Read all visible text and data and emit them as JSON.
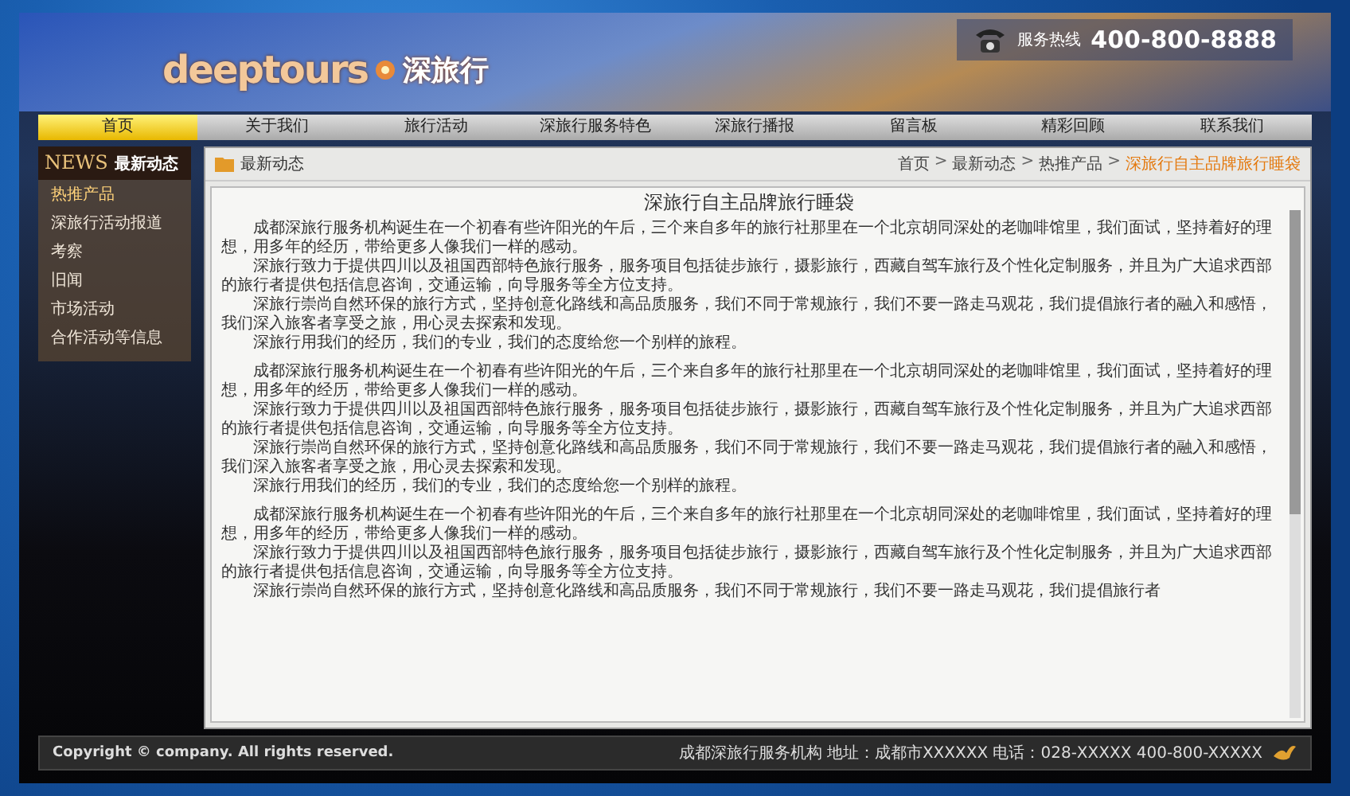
{
  "header": {
    "logo_text": "deeptours",
    "logo_cn": "深旅行",
    "hotline_label": "服务热线",
    "hotline": "400-800-8888"
  },
  "nav": [
    {
      "label": "首页",
      "selected": true
    },
    {
      "label": "关于我们",
      "selected": false
    },
    {
      "label": "旅行活动",
      "selected": false
    },
    {
      "label": "深旅行服务特色",
      "selected": false
    },
    {
      "label": "深旅行播报",
      "selected": false
    },
    {
      "label": "留言板",
      "selected": false
    },
    {
      "label": "精彩回顾",
      "selected": false
    },
    {
      "label": "联系我们",
      "selected": false
    }
  ],
  "sidebar": {
    "title_en": "NEWS",
    "title": "最新动态",
    "items": [
      {
        "label": "热推产品",
        "selected": true
      },
      {
        "label": "深旅行活动报道",
        "selected": false
      },
      {
        "label": "考察",
        "selected": false
      },
      {
        "label": "旧闻",
        "selected": false
      },
      {
        "label": "市场活动",
        "selected": false
      },
      {
        "label": "合作活动等信息",
        "selected": false
      }
    ]
  },
  "panel": {
    "title": "最新动态",
    "breadcrumb": [
      {
        "label": "首页",
        "current": false
      },
      {
        "label": "最新动态",
        "current": false
      },
      {
        "label": "热推产品",
        "current": false
      },
      {
        "label": "深旅行自主品牌旅行睡袋",
        "current": true
      }
    ],
    "separator": ">",
    "article_title": "深旅行自主品牌旅行睡袋",
    "groups": [
      {
        "paragraphs": [
          "成都深旅行服务机构诞生在一个初春有些许阳光的午后，三个来自多年的旅行社那里在一个北京胡同深处的老咖啡馆里，我们面试，坚持着好的理想，用多年的经历，带给更多人像我们一样的感动。",
          "深旅行致力于提供四川以及祖国西部特色旅行服务，服务项目包括徒步旅行，摄影旅行，西藏自驾车旅行及个性化定制服务，并且为广大追求西部的旅行者提供包括信息咨询，交通运输，向导服务等全方位支持。",
          "深旅行崇尚自然环保的旅行方式，坚持创意化路线和高品质服务，我们不同于常规旅行，我们不要一路走马观花，我们提倡旅行者的融入和感悟，我们深入旅客者享受之旅，用心灵去探索和发现。",
          "深旅行用我们的经历，我们的专业，我们的态度给您一个别样的旅程。"
        ]
      },
      {
        "paragraphs": [
          "成都深旅行服务机构诞生在一个初春有些许阳光的午后，三个来自多年的旅行社那里在一个北京胡同深处的老咖啡馆里，我们面试，坚持着好的理想，用多年的经历，带给更多人像我们一样的感动。",
          "深旅行致力于提供四川以及祖国西部特色旅行服务，服务项目包括徒步旅行，摄影旅行，西藏自驾车旅行及个性化定制服务，并且为广大追求西部的旅行者提供包括信息咨询，交通运输，向导服务等全方位支持。",
          "深旅行崇尚自然环保的旅行方式，坚持创意化路线和高品质服务，我们不同于常规旅行，我们不要一路走马观花，我们提倡旅行者的融入和感悟，我们深入旅客者享受之旅，用心灵去探索和发现。",
          "深旅行用我们的经历，我们的专业，我们的态度给您一个别样的旅程。"
        ]
      },
      {
        "paragraphs": [
          "成都深旅行服务机构诞生在一个初春有些许阳光的午后，三个来自多年的旅行社那里在一个北京胡同深处的老咖啡馆里，我们面试，坚持着好的理想，用多年的经历，带给更多人像我们一样的感动。",
          "深旅行致力于提供四川以及祖国西部特色旅行服务，服务项目包括徒步旅行，摄影旅行，西藏自驾车旅行及个性化定制服务，并且为广大追求西部的旅行者提供包括信息咨询，交通运输，向导服务等全方位支持。",
          "深旅行崇尚自然环保的旅行方式，坚持创意化路线和高品质服务，我们不同于常规旅行，我们不要一路走马观花，我们提倡旅行者"
        ]
      }
    ]
  },
  "footer": {
    "copyright": "Copyright © company. All rights reserved.",
    "contact": "成都深旅行服务机构 地址：成都市XXXXXX 电话：028-XXXXX 400-800-XXXXX"
  }
}
